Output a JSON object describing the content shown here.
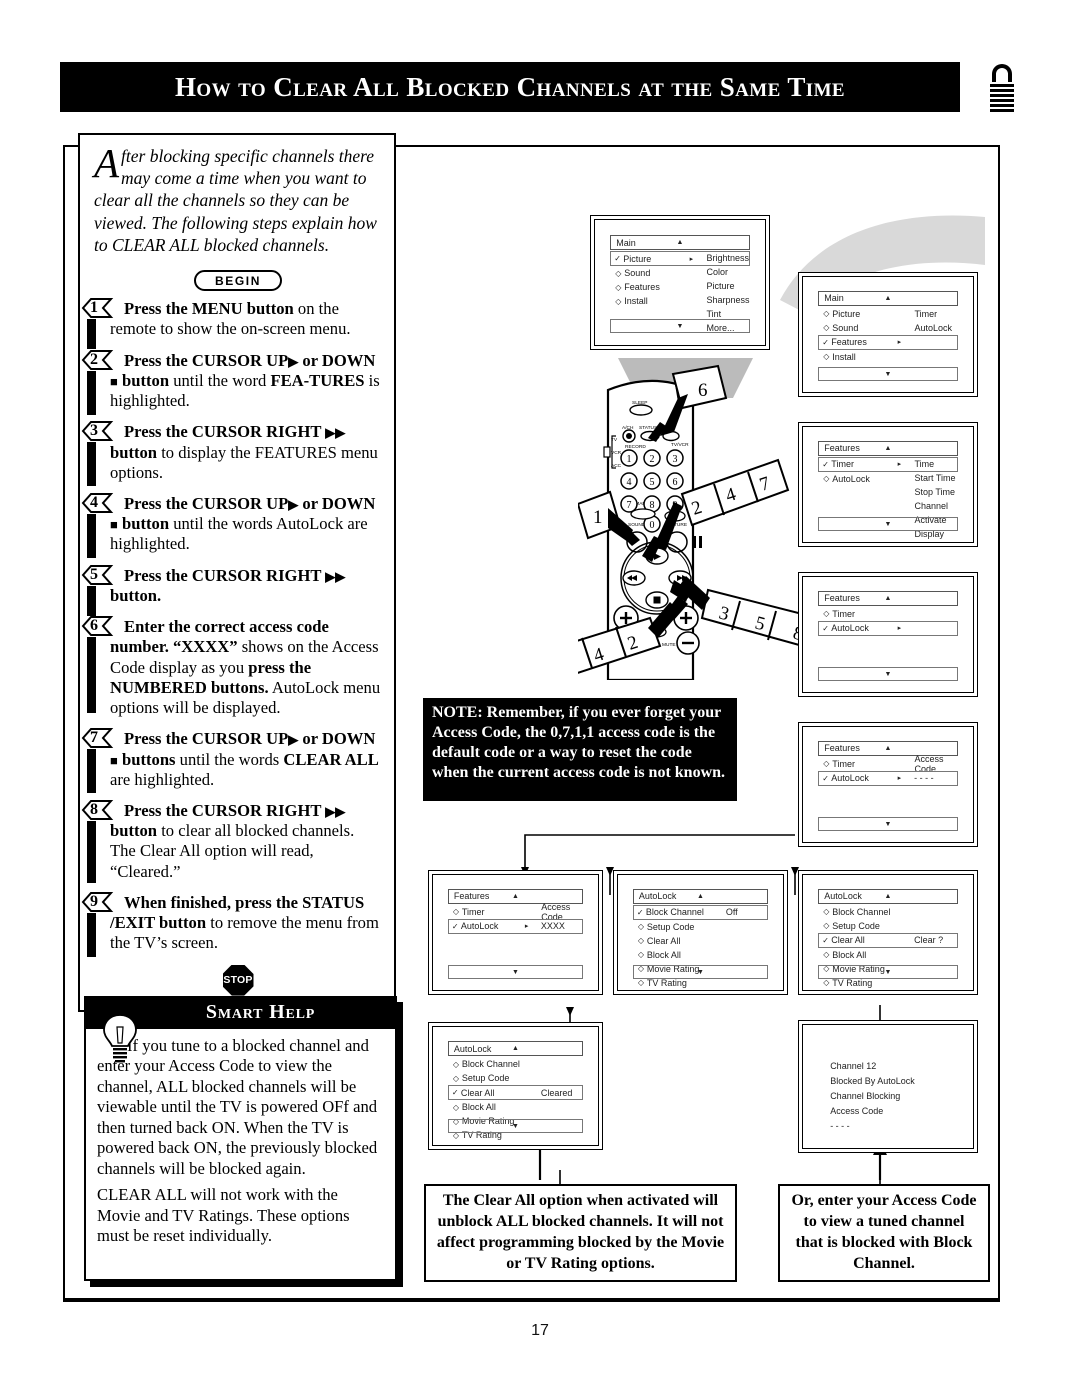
{
  "header": {
    "title": "How to Clear All Blocked Channels at the Same Time",
    "lock_icon": "padlock-icon"
  },
  "intro": {
    "dropcap": "A",
    "text": "fter blocking specific channels there may come a time when you want to clear all the channels so they can be viewed. The following steps explain how to CLEAR ALL blocked channels."
  },
  "begin_badge": "BEGIN",
  "stop_badge": "STOP",
  "steps": [
    {
      "num": "1",
      "html": "<b>Press the MENU button</b> on the remote to show the on-screen menu."
    },
    {
      "num": "2",
      "html": "<b>Press the CURSOR UP<span class=\"tri\">&#9654;</span> or DOWN <span class=\"tri\">&#9632;</span> button</b> until the word <b>FEA-TURES</b> is highlighted."
    },
    {
      "num": "3",
      "html": "<b>Press the CURSOR RIGHT <span class=\"tri\">&#9654;&#9654;</span> button</b> to display the FEATURES menu options."
    },
    {
      "num": "4",
      "html": "<b>Press the CURSOR UP<span class=\"tri\">&#9654;</span> or DOWN <span class=\"tri\">&#9632;</span> button</b> until the words AutoLock are highlighted."
    },
    {
      "num": "5",
      "html": "<b>Press the CURSOR RIGHT <span class=\"tri\">&#9654;&#9654;</span> button.</b>"
    },
    {
      "num": "6",
      "html": "<b>Enter the correct access code number. &ldquo;XXXX&rdquo;</b> shows on the Access Code display as you <b>press the NUMBERED buttons.</b> AutoLock menu options will be displayed."
    },
    {
      "num": "7",
      "html": "<b>Press the CURSOR UP<span class=\"tri\">&#9654;</span> or DOWN <span class=\"tri\">&#9632;</span> buttons</b> until the words <b>CLEAR ALL</b> are highlighted."
    },
    {
      "num": "8",
      "html": "<b>Press the CURSOR RIGHT <span class=\"tri\">&#9654;&#9654;</span> button</b> to clear all blocked channels. The Clear All option will read, &ldquo;Cleared.&rdquo;"
    },
    {
      "num": "9",
      "html": "<b>When finished, press the STATUS /EXIT button</b> to remove the menu from the TV&rsquo;s screen."
    }
  ],
  "smart_help": {
    "title": "Smart Help",
    "icon": "lightbulb-icon",
    "paragraphs": [
      "If you tune to a blocked channel and enter your Access Code to view the channel, ALL blocked channels will be viewable until the TV is powered OFf and then turned back ON. When the TV is powered back ON, the previously blocked channels will be blocked again.",
      "CLEAR ALL will not work with the Movie and TV Ratings. These options must be reset individually."
    ]
  },
  "note": {
    "text": "NOTE: Remember, if you ever forget your Access Code, the 0,7,1,1 access code is the default code or a way to reset the code when the current access code is not known."
  },
  "captions": [
    {
      "text": "The Clear All option when activated will unblock ALL blocked channels. It will not affect programming blocked by the Movie or TV Rating options."
    },
    {
      "text": "Or, enter your Access Code to view a tuned channel that is blocked with Block Channel."
    }
  ],
  "osd_screens": [
    {
      "id": "main-picture",
      "title": "Main",
      "up_arrow": "▲",
      "down_arrow": "▼",
      "rows": [
        {
          "mark": "✓",
          "label": "Picture",
          "selected": true,
          "arrow": "▸"
        },
        {
          "mark": "◇",
          "label": "Sound",
          "selected": false
        },
        {
          "mark": "◇",
          "label": "Features",
          "selected": false
        },
        {
          "mark": "◇",
          "label": "Install",
          "selected": false
        }
      ],
      "col2": [
        "Brightness",
        "Color",
        "Picture",
        "Sharpness",
        "Tint",
        "More..."
      ]
    },
    {
      "id": "main-features",
      "title": "Main",
      "up_arrow": "▲",
      "down_arrow": "▼",
      "rows": [
        {
          "mark": "◇",
          "label": "Picture",
          "selected": false
        },
        {
          "mark": "◇",
          "label": "Sound",
          "selected": false
        },
        {
          "mark": "✓",
          "label": "Features",
          "selected": true,
          "arrow": "▸"
        },
        {
          "mark": "◇",
          "label": "Install",
          "selected": false
        }
      ],
      "col2": [
        "Timer",
        "AutoLock"
      ]
    },
    {
      "id": "features-timer",
      "title": "Features",
      "up_arrow": "▲",
      "down_arrow": "▼",
      "rows": [
        {
          "mark": "✓",
          "label": "Timer",
          "selected": true,
          "arrow": "▸"
        },
        {
          "mark": "◇",
          "label": "AutoLock",
          "selected": false
        }
      ],
      "col2": [
        "Time",
        "Start Time",
        "Stop Time",
        "Channel",
        "Activate",
        "Display"
      ]
    },
    {
      "id": "features-autolock",
      "title": "Features",
      "up_arrow": "▲",
      "down_arrow": "▼",
      "rows": [
        {
          "mark": "◇",
          "label": "Timer",
          "selected": false
        },
        {
          "mark": "✓",
          "label": "AutoLock",
          "selected": true,
          "arrow": "▸"
        }
      ],
      "col2": []
    },
    {
      "id": "features-accesscode-blank",
      "title": "Features",
      "up_arrow": "▲",
      "down_arrow": "▼",
      "rows": [
        {
          "mark": "◇",
          "label": "Timer",
          "selected": false,
          "value": "Access Code"
        },
        {
          "mark": "✓",
          "label": "AutoLock",
          "selected": true,
          "arrow": "▸",
          "value": "- - - -"
        }
      ],
      "col2": []
    },
    {
      "id": "features-accesscode-xxxx",
      "title": "Features",
      "up_arrow": "▲",
      "down_arrow": "▼",
      "rows": [
        {
          "mark": "◇",
          "label": "Timer",
          "selected": false,
          "value": "Access Code"
        },
        {
          "mark": "✓",
          "label": "AutoLock",
          "selected": true,
          "arrow": "▸",
          "value": "XXXX"
        }
      ],
      "col2": []
    },
    {
      "id": "autolock-blockchannel",
      "title": "AutoLock",
      "up_arrow": "▲",
      "down_arrow": "▼",
      "rows": [
        {
          "mark": "✓",
          "label": "Block Channel",
          "selected": true,
          "value": "Off"
        },
        {
          "mark": "◇",
          "label": "Setup Code",
          "selected": false
        },
        {
          "mark": "◇",
          "label": "Clear All",
          "selected": false
        },
        {
          "mark": "◇",
          "label": "Block All",
          "selected": false
        },
        {
          "mark": "◇",
          "label": "Movie Rating",
          "selected": false
        },
        {
          "mark": "◇",
          "label": "TV Rating",
          "selected": false
        }
      ],
      "col2": []
    },
    {
      "id": "autolock-clearall-query",
      "title": "AutoLock",
      "up_arrow": "▲",
      "down_arrow": "▼",
      "rows": [
        {
          "mark": "◇",
          "label": "Block Channel",
          "selected": false
        },
        {
          "mark": "◇",
          "label": "Setup Code",
          "selected": false
        },
        {
          "mark": "✓",
          "label": "Clear All",
          "selected": true,
          "value": "Clear ?"
        },
        {
          "mark": "◇",
          "label": "Block All",
          "selected": false
        },
        {
          "mark": "◇",
          "label": "Movie Rating",
          "selected": false
        },
        {
          "mark": "◇",
          "label": "TV Rating",
          "selected": false
        }
      ],
      "col2": []
    },
    {
      "id": "autolock-cleared",
      "title": "AutoLock",
      "up_arrow": "▲",
      "down_arrow": "▼",
      "rows": [
        {
          "mark": "◇",
          "label": "Block Channel",
          "selected": false
        },
        {
          "mark": "◇",
          "label": "Setup Code",
          "selected": false
        },
        {
          "mark": "✓",
          "label": "Clear All",
          "selected": true,
          "value": "Cleared"
        },
        {
          "mark": "◇",
          "label": "Block All",
          "selected": false
        },
        {
          "mark": "◇",
          "label": "Movie Rating",
          "selected": false
        },
        {
          "mark": "◇",
          "label": "TV Rating",
          "selected": false
        }
      ],
      "col2": []
    }
  ],
  "blocked_screen": {
    "lines": [
      "Channel 12",
      "Blocked By AutoLock",
      "Channel Blocking",
      "Access Code",
      "- - - -"
    ]
  },
  "remote": {
    "labels": [
      "SLEEP",
      "A/CH",
      "STATUS/EXIT",
      "CC",
      "RECORD",
      "TV",
      "VCR",
      "ACC",
      "POWER",
      "TV/VCR",
      "SMART",
      "SOUND",
      "PICTURE",
      "MENU",
      "SURF",
      "MUTE",
      "VOL",
      "CH"
    ],
    "keypad": [
      "1",
      "2",
      "3",
      "4",
      "5",
      "6",
      "7",
      "8",
      "9",
      "0"
    ],
    "callouts": [
      "1",
      "2",
      "3",
      "4",
      "5",
      "6",
      "7",
      "8"
    ]
  },
  "page_number": "17"
}
